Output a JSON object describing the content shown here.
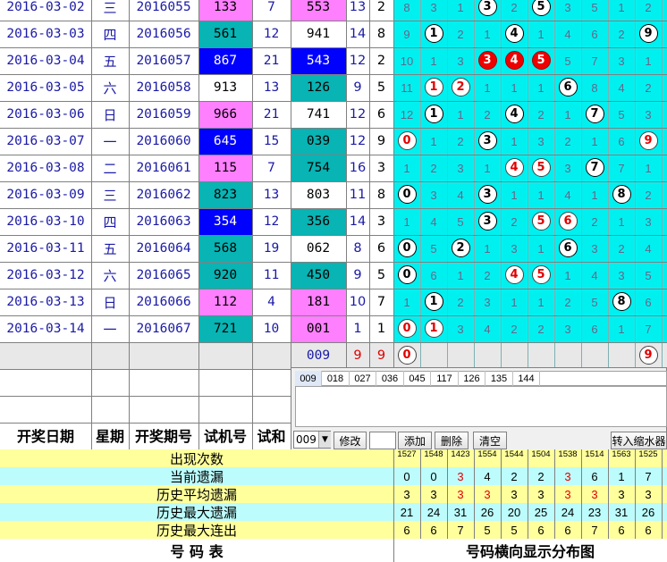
{
  "colors": {
    "cyan": "#00f0f0",
    "teal": "#08b4b4",
    "pink": "#ff80ff",
    "blue": "#0000ff",
    "stripe_cyan": "#bdfcfc",
    "stripe_yellow": "#ffff9c",
    "gray": "#e8e8e8"
  },
  "rows": [
    {
      "date": "2016-03-02",
      "week": "三",
      "period": "2016055",
      "trial": "133",
      "span": "7",
      "result": "553",
      "sum": "13",
      "c": "2",
      "trial_bg": "pink",
      "result_bg": "pink",
      "cells": [
        {
          "t": "8"
        },
        {
          "t": "3"
        },
        {
          "t": "1"
        },
        {
          "t": "3",
          "s": "w"
        },
        {
          "t": "2"
        },
        {
          "t": "5",
          "s": "w"
        },
        {
          "t": "3"
        },
        {
          "t": "5"
        },
        {
          "t": "1"
        },
        {
          "t": "2"
        }
      ]
    },
    {
      "date": "2016-03-03",
      "week": "四",
      "period": "2016056",
      "trial": "561",
      "span": "12",
      "result": "941",
      "sum": "14",
      "c": "8",
      "trial_bg": "teal",
      "result_bg": "white",
      "cells": [
        {
          "t": "9"
        },
        {
          "t": "1",
          "s": "w"
        },
        {
          "t": "2"
        },
        {
          "t": "1"
        },
        {
          "t": "4",
          "s": "w"
        },
        {
          "t": "1"
        },
        {
          "t": "4"
        },
        {
          "t": "6"
        },
        {
          "t": "2"
        },
        {
          "t": "9",
          "s": "w"
        }
      ]
    },
    {
      "date": "2016-03-04",
      "week": "五",
      "period": "2016057",
      "trial": "867",
      "span": "21",
      "result": "543",
      "sum": "12",
      "c": "2",
      "trial_bg": "blue",
      "result_bg": "blue",
      "cells": [
        {
          "t": "10"
        },
        {
          "t": "1"
        },
        {
          "t": "3"
        },
        {
          "t": "3",
          "s": "r"
        },
        {
          "t": "4",
          "s": "r"
        },
        {
          "t": "5",
          "s": "r"
        },
        {
          "t": "5"
        },
        {
          "t": "7"
        },
        {
          "t": "3"
        },
        {
          "t": "1"
        }
      ]
    },
    {
      "date": "2016-03-05",
      "week": "六",
      "period": "2016058",
      "trial": "913",
      "span": "13",
      "result": "126",
      "sum": "9",
      "c": "5",
      "trial_bg": "white",
      "result_bg": "teal",
      "cells": [
        {
          "t": "11"
        },
        {
          "t": "1",
          "s": "wr"
        },
        {
          "t": "2",
          "s": "wr"
        },
        {
          "t": "1"
        },
        {
          "t": "1"
        },
        {
          "t": "1"
        },
        {
          "t": "6",
          "s": "w"
        },
        {
          "t": "8"
        },
        {
          "t": "4"
        },
        {
          "t": "2"
        }
      ]
    },
    {
      "date": "2016-03-06",
      "week": "日",
      "period": "2016059",
      "trial": "966",
      "span": "21",
      "result": "741",
      "sum": "12",
      "c": "6",
      "trial_bg": "pink",
      "result_bg": "white",
      "cells": [
        {
          "t": "12"
        },
        {
          "t": "1",
          "s": "w"
        },
        {
          "t": "1"
        },
        {
          "t": "2"
        },
        {
          "t": "4",
          "s": "w"
        },
        {
          "t": "2"
        },
        {
          "t": "1"
        },
        {
          "t": "7",
          "s": "w"
        },
        {
          "t": "5"
        },
        {
          "t": "3"
        }
      ]
    },
    {
      "date": "2016-03-07",
      "week": "一",
      "period": "2016060",
      "trial": "645",
      "span": "15",
      "result": "039",
      "sum": "12",
      "c": "9",
      "trial_bg": "blue",
      "result_bg": "teal",
      "cells": [
        {
          "t": "0",
          "s": "wr"
        },
        {
          "t": "1"
        },
        {
          "t": "2"
        },
        {
          "t": "3",
          "s": "w"
        },
        {
          "t": "1"
        },
        {
          "t": "3"
        },
        {
          "t": "2"
        },
        {
          "t": "1"
        },
        {
          "t": "6"
        },
        {
          "t": "9",
          "s": "wr"
        }
      ]
    },
    {
      "date": "2016-03-08",
      "week": "二",
      "period": "2016061",
      "trial": "115",
      "span": "7",
      "result": "754",
      "sum": "16",
      "c": "3",
      "trial_bg": "pink",
      "result_bg": "teal",
      "cells": [
        {
          "t": "1"
        },
        {
          "t": "2"
        },
        {
          "t": "3"
        },
        {
          "t": "1"
        },
        {
          "t": "4",
          "s": "wr"
        },
        {
          "t": "5",
          "s": "wr"
        },
        {
          "t": "3"
        },
        {
          "t": "7",
          "s": "w"
        },
        {
          "t": "7"
        },
        {
          "t": "1"
        }
      ]
    },
    {
      "date": "2016-03-09",
      "week": "三",
      "period": "2016062",
      "trial": "823",
      "span": "13",
      "result": "803",
      "sum": "11",
      "c": "8",
      "trial_bg": "teal",
      "result_bg": "white",
      "cells": [
        {
          "t": "0",
          "s": "w"
        },
        {
          "t": "3"
        },
        {
          "t": "4"
        },
        {
          "t": "3",
          "s": "w"
        },
        {
          "t": "1"
        },
        {
          "t": "1"
        },
        {
          "t": "4"
        },
        {
          "t": "1"
        },
        {
          "t": "8",
          "s": "w"
        },
        {
          "t": "2"
        }
      ]
    },
    {
      "date": "2016-03-10",
      "week": "四",
      "period": "2016063",
      "trial": "354",
      "span": "12",
      "result": "356",
      "sum": "14",
      "c": "3",
      "trial_bg": "blue",
      "result_bg": "teal",
      "cells": [
        {
          "t": "1"
        },
        {
          "t": "4"
        },
        {
          "t": "5"
        },
        {
          "t": "3",
          "s": "w"
        },
        {
          "t": "2"
        },
        {
          "t": "5",
          "s": "wr"
        },
        {
          "t": "6",
          "s": "wr"
        },
        {
          "t": "2"
        },
        {
          "t": "1"
        },
        {
          "t": "3"
        }
      ]
    },
    {
      "date": "2016-03-11",
      "week": "五",
      "period": "2016064",
      "trial": "568",
      "span": "19",
      "result": "062",
      "sum": "8",
      "c": "6",
      "trial_bg": "teal",
      "result_bg": "white",
      "cells": [
        {
          "t": "0",
          "s": "w"
        },
        {
          "t": "5"
        },
        {
          "t": "2",
          "s": "w"
        },
        {
          "t": "1"
        },
        {
          "t": "3"
        },
        {
          "t": "1"
        },
        {
          "t": "6",
          "s": "w"
        },
        {
          "t": "3"
        },
        {
          "t": "2"
        },
        {
          "t": "4"
        }
      ]
    },
    {
      "date": "2016-03-12",
      "week": "六",
      "period": "2016065",
      "trial": "920",
      "span": "11",
      "result": "450",
      "sum": "9",
      "c": "5",
      "trial_bg": "teal",
      "result_bg": "teal",
      "cells": [
        {
          "t": "0",
          "s": "w"
        },
        {
          "t": "6"
        },
        {
          "t": "1"
        },
        {
          "t": "2"
        },
        {
          "t": "4",
          "s": "wr"
        },
        {
          "t": "5",
          "s": "wr"
        },
        {
          "t": "1"
        },
        {
          "t": "4"
        },
        {
          "t": "3"
        },
        {
          "t": "5"
        }
      ]
    },
    {
      "date": "2016-03-13",
      "week": "日",
      "period": "2016066",
      "trial": "112",
      "span": "4",
      "result": "181",
      "sum": "10",
      "c": "7",
      "trial_bg": "pink",
      "result_bg": "pink",
      "cells": [
        {
          "t": "1"
        },
        {
          "t": "1",
          "s": "w"
        },
        {
          "t": "2"
        },
        {
          "t": "3"
        },
        {
          "t": "1"
        },
        {
          "t": "1"
        },
        {
          "t": "2"
        },
        {
          "t": "5"
        },
        {
          "t": "8",
          "s": "w"
        },
        {
          "t": "6"
        }
      ]
    },
    {
      "date": "2016-03-14",
      "week": "一",
      "period": "2016067",
      "trial": "721",
      "span": "10",
      "result": "001",
      "sum": "1",
      "c": "1",
      "trial_bg": "teal",
      "result_bg": "pink",
      "cells": [
        {
          "t": "0",
          "s": "wr"
        },
        {
          "t": "1",
          "s": "wr"
        },
        {
          "t": "3"
        },
        {
          "t": "4"
        },
        {
          "t": "2"
        },
        {
          "t": "2"
        },
        {
          "t": "3"
        },
        {
          "t": "6"
        },
        {
          "t": "1"
        },
        {
          "t": "7"
        }
      ]
    }
  ],
  "current": {
    "result": "009",
    "sum": "9",
    "c": "9",
    "cells": [
      {
        "t": "0",
        "s": "wr",
        "col": 0
      },
      {
        "t": "9",
        "s": "wr",
        "col": 9
      }
    ]
  },
  "headers": {
    "date": "开奖日期",
    "week": "星期",
    "period": "开奖期号",
    "trial": "试机号",
    "span": "试和"
  },
  "panel": {
    "tabs": [
      "009",
      "018",
      "027",
      "036",
      "045",
      "117",
      "126",
      "135",
      "144"
    ],
    "select": "009",
    "edit": "修改",
    "add": "添加",
    "delete": "删除",
    "clear": "清空",
    "transfer": "转入缩水器",
    "input": ""
  },
  "stats": {
    "occurrence": {
      "label": "出现次数",
      "values": [
        "1527",
        "1548",
        "1423",
        "1554",
        "1544",
        "1504",
        "1538",
        "1514",
        "1563",
        "1525"
      ]
    },
    "current_miss": {
      "label": "当前遗漏",
      "values": [
        "0",
        "0",
        "3",
        "4",
        "2",
        "2",
        "3",
        "6",
        "1",
        "7"
      ]
    },
    "avg_miss": {
      "label": "历史平均遗漏",
      "values": [
        "3",
        "3",
        "3",
        "3",
        "3",
        "3",
        "3",
        "3",
        "3",
        "3"
      ]
    },
    "max_miss": {
      "label": "历史最大遗漏",
      "values": [
        "21",
        "24",
        "31",
        "26",
        "20",
        "25",
        "24",
        "23",
        "31",
        "26"
      ]
    },
    "max_consec": {
      "label": "历史最大连出",
      "values": [
        "6",
        "6",
        "7",
        "5",
        "5",
        "6",
        "6",
        "7",
        "6",
        "6"
      ]
    }
  },
  "footer": {
    "left": "号  码  表",
    "right": "号码横向显示分布图"
  }
}
